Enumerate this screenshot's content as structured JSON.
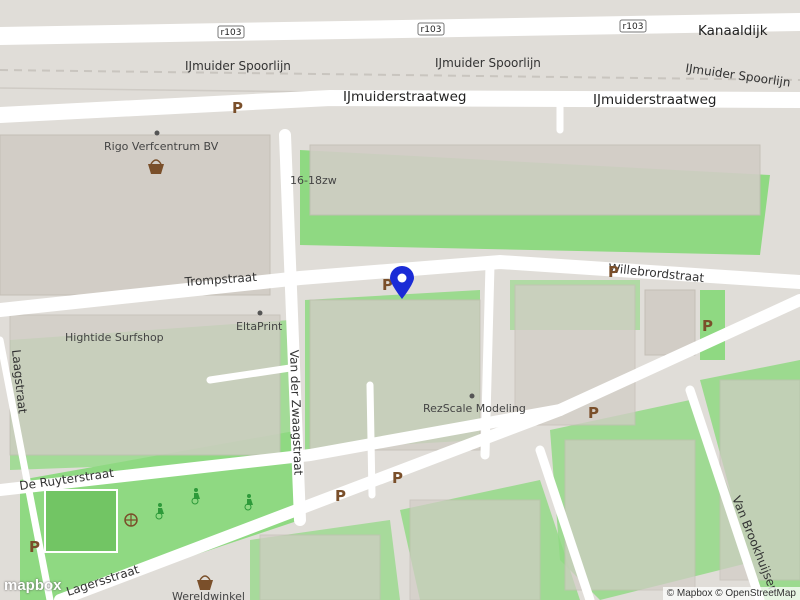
{
  "roads": {
    "r103_shield": "r103",
    "kanaaldijk": "Kanaaldijk",
    "ijmuider_spoorlijn": "IJmuider Spoorlijn",
    "ijmuiderstraatweg": "IJmuiderstraatweg",
    "trompstraat": "Trompstraat",
    "willebrordstraat": "Willebrordstraat",
    "van_der_zwaagstraat": "Van der Zwaagstraat",
    "de_ruyterstraat": "De Ruyterstraat",
    "lagersstraat": "Lagersstraat",
    "van_brookhuijsen": "Van Brookhuijsen",
    "left_street": "Laagstraat"
  },
  "pois": {
    "rigo": "Rigo Verfcentrum BV",
    "hightide": "Hightide Surfshop",
    "eltaprint": "EltaPrint",
    "rezscale": "RezScale Modeling",
    "wereldwinkel": "Wereldwinkel"
  },
  "house_number": "16-18zw",
  "parking_label": "P",
  "attribution": {
    "mapbox": "© Mapbox",
    "osm": "© OpenStreetMap"
  },
  "logo": "mapbox",
  "colors": {
    "road": "#ffffff",
    "building": "#d2cdc6",
    "green": "#8fd982",
    "land": "#e0ddd8",
    "marker": "#1a2bd6",
    "parking": "#7a4f2a"
  },
  "icons": {
    "marker": "location-pin-icon",
    "shop": "basket-icon",
    "playground": "playground-icon",
    "disabled": "wheelchair-icon"
  }
}
